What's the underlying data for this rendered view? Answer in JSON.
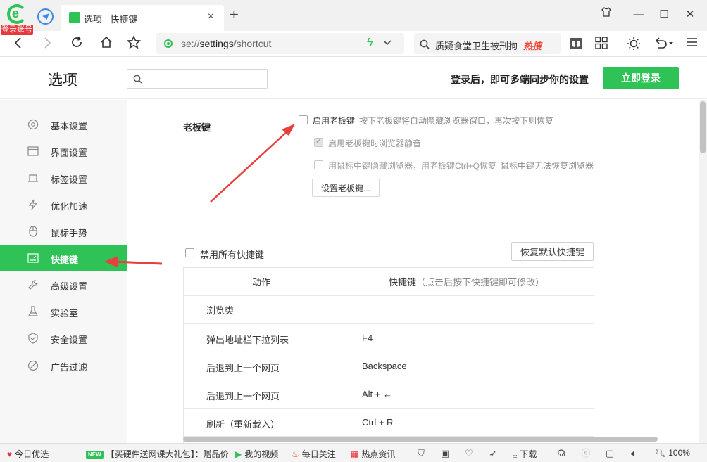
{
  "browser": {
    "account_badge": "登录账号",
    "tab_title": "选项 - 快捷键",
    "tab_close": "×",
    "new_tab": "+",
    "url_prefix": "se://",
    "url_path": "settings",
    "url_suffix": "/shortcut",
    "search_text": "质疑食堂卫生被刑拘",
    "search_hot": "热搜"
  },
  "header": {
    "title": "选项",
    "search_placeholder": "",
    "sync_text": "登录后，即可多端同步你的设置",
    "login_button": "立即登录"
  },
  "sidebar": {
    "items": [
      {
        "label": "基本设置",
        "icon": "gear-icon"
      },
      {
        "label": "界面设置",
        "icon": "layout-icon"
      },
      {
        "label": "标签设置",
        "icon": "tab-icon"
      },
      {
        "label": "优化加速",
        "icon": "bolt-icon"
      },
      {
        "label": "鼠标手势",
        "icon": "mouse-icon"
      },
      {
        "label": "快捷键",
        "icon": "keyboard-icon",
        "active": true
      },
      {
        "label": "高级设置",
        "icon": "wrench-icon"
      },
      {
        "label": "实验室",
        "icon": "flask-icon"
      },
      {
        "label": "安全设置",
        "icon": "shield-icon"
      },
      {
        "label": "广告过滤",
        "icon": "block-icon"
      }
    ]
  },
  "bosskey": {
    "section_title": "老板键",
    "enable_label": "启用老板键",
    "enable_hint": "按下老板键将自动隐藏浏览器窗口，再次按下则恢复",
    "mute_label": "启用老板键时浏览器静音",
    "middle_label": "用鼠标中键隐藏浏览器，用老板键Ctrl+Q恢复",
    "middle_hint": "鼠标中键无法恢复浏览器",
    "set_button": "设置老板键..."
  },
  "shortcuts": {
    "disable_all_label": "禁用所有快捷键",
    "restore_button": "恢复默认快捷键",
    "col_action": "动作",
    "col_key": "快捷键",
    "col_key_hint": "（点击后按下快捷键即可修改）",
    "category": "浏览类",
    "rows": [
      {
        "action": "弹出地址栏下拉列表",
        "key": "F4"
      },
      {
        "action": "后退到上一个网页",
        "key": "Backspace"
      },
      {
        "action": "后退到上一个网页",
        "key": "Alt + ←"
      },
      {
        "action": "刷新（重新载入）",
        "key": "Ctrl + R"
      }
    ]
  },
  "statusbar": {
    "today": "今日优选",
    "new_badge": "NEW",
    "promo": "【买硬件送网课大礼包】：赠品价",
    "video": "我的视频",
    "follow": "每日关注",
    "news": "热点资讯",
    "download": "下载",
    "zoom": "100%"
  },
  "colors": {
    "accent": "#2ec257",
    "arrow": "#e8403b"
  }
}
